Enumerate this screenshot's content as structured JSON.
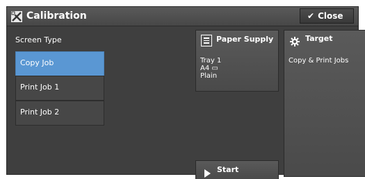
{
  "header": {
    "title": "Calibration",
    "close_label": "Close",
    "app_icon": "calibration-icon"
  },
  "screen_type": {
    "label": "Screen Type",
    "items": [
      {
        "label": "Copy Job",
        "selected": true
      },
      {
        "label": "Print Job 1",
        "selected": false
      },
      {
        "label": "Print Job 2",
        "selected": false
      }
    ]
  },
  "paper_supply": {
    "title": "Paper Supply",
    "tray": "Tray 1",
    "size": "A4 ▭",
    "type": "Plain"
  },
  "target": {
    "title": "Target",
    "value": "Copy & Print Jobs"
  },
  "start": {
    "label": "Start"
  },
  "colors": {
    "panel": "#3f3f3f",
    "selected": "#5a97d3",
    "tile": "#4f4f4f"
  }
}
